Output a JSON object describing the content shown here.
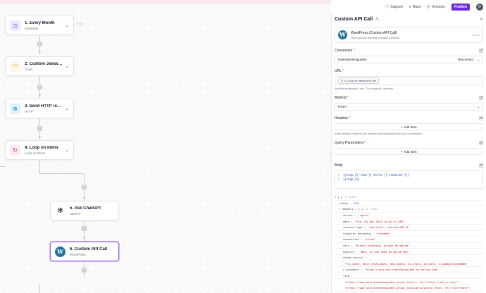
{
  "header": {
    "support": "Support",
    "runs": "Runs",
    "versions": "Versions",
    "publish": "Publish",
    "avatar": "D"
  },
  "flow": {
    "ghost_label": "Flow",
    "nodes": [
      {
        "title": "1. Every Month",
        "subtitle": "Schedule",
        "icon": "clock-icon"
      },
      {
        "title": "2. Custom Javascript ...",
        "subtitle": "Code",
        "icon": "code-icon"
      },
      {
        "title": "3. Send HTTP request",
        "subtitle": "HTTP",
        "icon": "globe-icon"
      },
      {
        "title": "4. Loop on Items",
        "subtitle": "Loop on Items",
        "icon": "loop-icon"
      },
      {
        "title": "5. Ask ChatGPT",
        "subtitle": "OpenAI",
        "icon": "openai-icon"
      },
      {
        "title": "6. Custom API Call",
        "subtitle": "WordPress",
        "icon": "wordpress-icon"
      }
    ]
  },
  "panel": {
    "title": "Custom API Call",
    "piece": {
      "name": "WordPress (Custom API Call)",
      "description": "Open-source website creation software",
      "version": "v0.3.1"
    },
    "connection": {
      "label": "Connection",
      "value": "Katrineholmsguiden",
      "action": "Reconnect"
    },
    "url": {
      "label": "URL",
      "tag": "4. Loop on Items item link",
      "hint": "Add the endpoint to use. For example, /models"
    },
    "method": {
      "label": "Method",
      "value": "POST"
    },
    "headers": {
      "label": "Headers",
      "add": "+ Add Item",
      "hint": "Authorization headers are injected automatically from your connection."
    },
    "query": {
      "label": "Query Parameters",
      "add": "+ Add Item"
    },
    "body": {
      "label": "Body",
      "lines": [
        {
          "n": "1",
          "text": "{{step_2['item']['title']['rendered']}}"
        },
        {
          "n": "2",
          "text": "{{step_5}}"
        }
      ]
    },
    "output": [
      {
        "k": "▾ { }",
        "v": "3 items",
        "t": "meta"
      },
      {
        "k": "status :",
        "v": "200",
        "t": "num"
      },
      {
        "k": "▾ headers : { }",
        "v": "22 items",
        "t": "meta"
      },
      {
        "k": "server :",
        "v": "\"nginx\"",
        "t": "str"
      },
      {
        "k": "date :",
        "v": "\"Tue, 04 Apr 2023 14:05:41 GMT\"",
        "t": "str"
      },
      {
        "k": "content-type :",
        "v": "\"text/html; charset=UTF-8\"",
        "t": "str"
      },
      {
        "k": "transfer-encoding :",
        "v": "\"chunked\"",
        "t": "str"
      },
      {
        "k": "connection :",
        "v": "\"close\"",
        "t": "str"
      },
      {
        "k": "vary :",
        "v": "\"Accept-Encoding, Accept-Encoding\"",
        "t": "str"
      },
      {
        "k": "expires :",
        "v": "\"Wed, 11 Jan 1984 05:00:00 GMT\"",
        "t": "str"
      },
      {
        "k": "cache-control :",
        "v": "",
        "t": "str"
      },
      {
        "k": "",
        "v": "\"no-cache, must-revalidate, max-age=0, no-store, private, s-maxage=31536000\"",
        "t": "str"
      },
      {
        "k": "x-pingback :",
        "v": "\"https://www.katrineholmsguiden.se/xmlrpc.php\"",
        "t": "str"
      },
      {
        "k": "link :",
        "v": "",
        "t": "str"
      },
      {
        "k": "",
        "v": "\"https://www.katrineholmsguiden.se/wp-json/>; rel=\"https://api.w.org/\",",
        "t": "str"
      },
      {
        "k": "",
        "v": "<https://www.katrineholmsguiden.se/wp-json/wp/v2/posts/7520>; rel=\"alternate\";",
        "t": "str"
      },
      {
        "k": "",
        "v": "title=\"JSON\"; type=\"application/json\", <https://www.katrineholmsguiden.se/?p=7520>;",
        "t": "str"
      },
      {
        "k": "",
        "v": "rel=shortlink\"",
        "t": "str"
      }
    ]
  },
  "colors": {
    "accent": "#6d28d9",
    "selected_border": "#9b6bf2",
    "wordpress": "#21759b"
  }
}
